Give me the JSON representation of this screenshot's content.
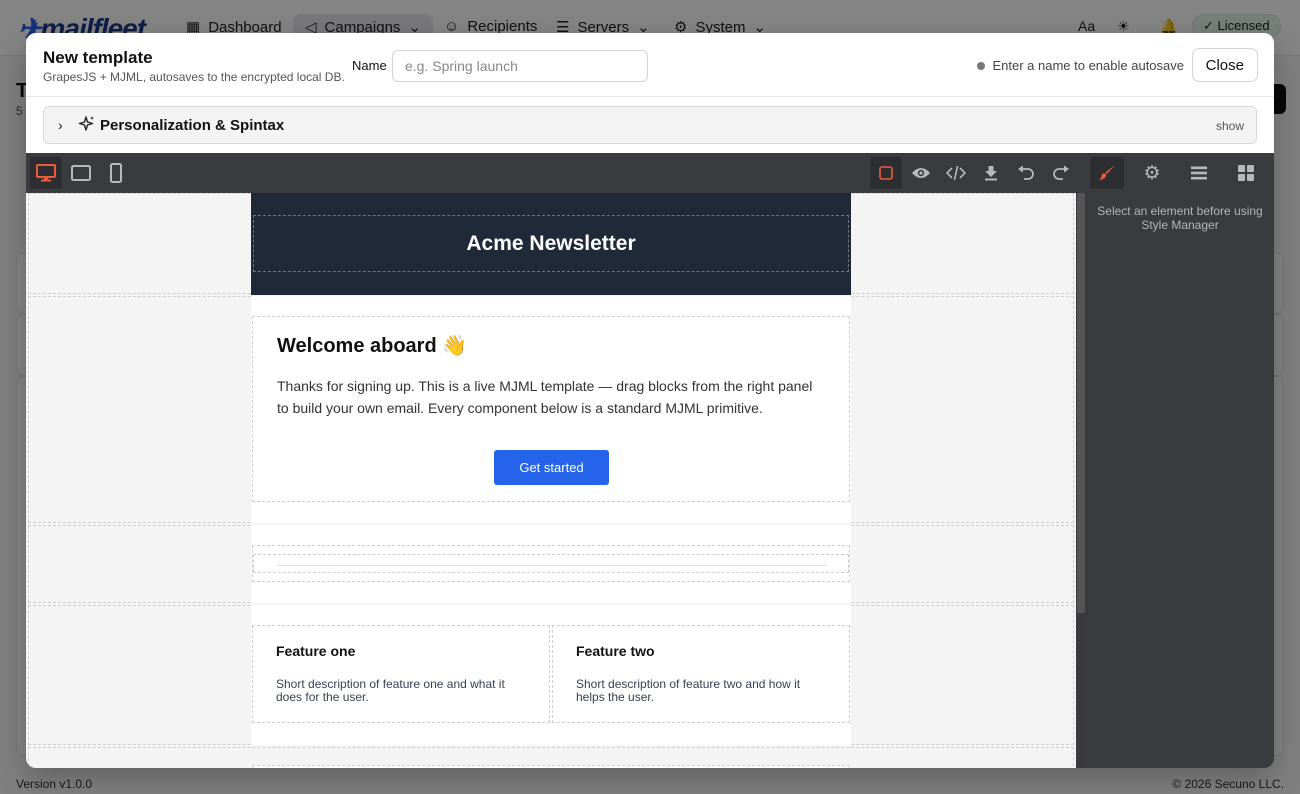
{
  "app": {
    "logo": "mailfleet",
    "nav": [
      {
        "label": "Dashboard"
      },
      {
        "label": "Campaigns"
      },
      {
        "label": "Recipients"
      },
      {
        "label": "Servers"
      },
      {
        "label": "System"
      }
    ],
    "license_badge": "Licensed",
    "page_title": "T",
    "page_sub": "5",
    "footer_version": "Version v1.0.0",
    "footer_copyright": "© 2026 Secuno LLC."
  },
  "modal": {
    "title": "New template",
    "subtitle": "GrapesJS + MJML, autosaves to the encrypted local DB.",
    "name_label": "Name",
    "name_placeholder": "e.g. Spring launch",
    "name_value": "",
    "autosave_status": "Enter a name to enable autosave",
    "close_label": "Close",
    "personalization": {
      "label": "Personalization & Spintax",
      "toggle": "show"
    }
  },
  "editor": {
    "devices": [
      "desktop",
      "tablet",
      "mobile"
    ],
    "active_device": "desktop",
    "actions": [
      "outline",
      "preview",
      "code",
      "export",
      "undo",
      "redo"
    ],
    "panels": [
      "style-manager",
      "settings",
      "layers",
      "blocks"
    ],
    "active_panel": "style-manager",
    "style_manager_message": "Select an element before using Style Manager",
    "colors": {
      "accent": "#f05a3c",
      "toolbar": "#3a3b3e",
      "canvas": "#f4f4f4"
    }
  },
  "email": {
    "header_title": "Acme Newsletter",
    "header_bg": "#1f2937",
    "welcome_heading": "Welcome aboard 👋",
    "welcome_body": "Thanks for signing up. This is a live MJML template — drag blocks from the right panel to build your own email. Every component below is a standard MJML primitive.",
    "cta_label": "Get started",
    "cta_color": "#2563eb",
    "features": [
      {
        "title": "Feature one",
        "body": "Short description of feature one and what it does for the user."
      },
      {
        "title": "Feature two",
        "body": "Short description of feature two and how it helps the user."
      }
    ]
  }
}
